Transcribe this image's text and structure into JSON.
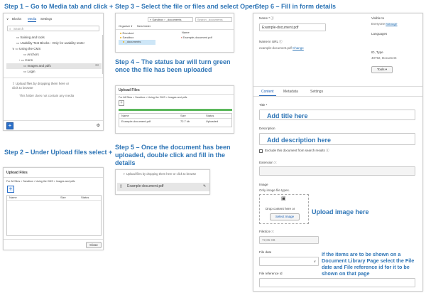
{
  "steps": {
    "s1": "Step 1 – Go to Media tab and click +",
    "s2": "Step 2 – Under Upload files select +",
    "s3": "Step 3 – Select the file or files and select Open",
    "s4": "Step 4 – The status bar will turn green once the file has been uploaded",
    "s5": "Step 5 – Once the document has been uploaded, double click and fill in the details",
    "s6": "Step 6 – Fill in form details"
  },
  "media_panel": {
    "tabs": [
      "Blocks",
      "Media",
      "Settings"
    ],
    "search_placeholder": "Search",
    "tree": [
      "training and tools",
      "Usability Test Blocks - Only for usability tests!",
      "Using the CMS",
      "Anchors",
      "Icons",
      "Images and pdfs",
      "Login"
    ],
    "drop_text": "Upload files by dropping them here or click to browse",
    "empty_text": "This folder does not contain any media"
  },
  "upload_dialog": {
    "title": "Upload Files",
    "breadcrumb": "For All Sites  >  Sandbox  >  Using the CMS  >  Images and pdfs",
    "columns": [
      "Name",
      "Size",
      "Status"
    ],
    "close_label": "Close"
  },
  "file_dialog": {
    "path": "« Sandbox › _documents",
    "search": "Search _documents",
    "organize": "Organize ▾",
    "new_folder": "New folder",
    "name_header": "Name",
    "folders": [
      "Revoked",
      "Sandbox",
      "_documents"
    ],
    "file": "Example-document.pdf"
  },
  "upload_status": {
    "title": "Upload Files",
    "breadcrumb": "For All Sites  >  Sandbox  >  Using the CMS  >  Images and pdfs",
    "columns": [
      "Name",
      "Size",
      "Status"
    ],
    "row": {
      "name": "Example-document.pdf",
      "size": "72.7 kb",
      "status": "Uploaded"
    },
    "progress": 1.0
  },
  "uploaded_item": {
    "drop_text": "Upload files by dropping them here or click to browse",
    "file": "Example-document.pdf"
  },
  "form": {
    "name_label": "Name *",
    "name_value": "Example-document.pdf",
    "url_label": "Name in URL",
    "url_value": "example-document.pdf",
    "url_link": "Change",
    "visible_label": "Visible to",
    "visible_value": "Everyone",
    "visible_link": "Manage",
    "languages_label": "Languages",
    "id_label": "ID, Type",
    "id_value": "40792, Document",
    "tools_label": "Tools ▾",
    "tabs": [
      "Content",
      "Metadata",
      "Settings"
    ],
    "title_label": "Title *",
    "title_note": "Add title here",
    "description_label": "Description",
    "description_note": "Add description here",
    "exclude_label": "Exclude this document from search results",
    "extension_label": "Extension",
    "image_label": "Image",
    "image_types": "Only image file types.",
    "drop_content": "Drop content here or",
    "select_image": "Select Image",
    "upload_note": "Upload image here",
    "filesize_label": "FileSize",
    "filesize_value": "72,65 KB",
    "filedate_label": "File date",
    "fileref_label": "File reference Id",
    "side_note": "If the items are to be shown on a Document Library Page select the File date and File reference id for it to be shown on that page"
  }
}
